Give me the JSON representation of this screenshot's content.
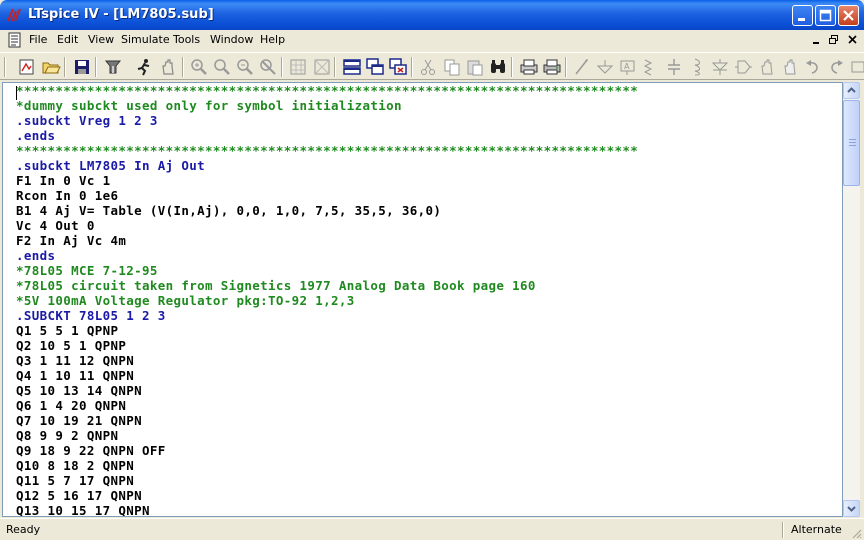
{
  "window": {
    "title": "LTspice IV - [LM7805.sub]"
  },
  "menu": {
    "items": [
      {
        "label": "File"
      },
      {
        "label": "Edit"
      },
      {
        "label": "View"
      },
      {
        "label": "Simulate"
      },
      {
        "label": "Tools"
      },
      {
        "label": "Window"
      },
      {
        "label": "Help"
      }
    ]
  },
  "toolbar": {
    "icons": [
      "new-schematic-icon",
      "open-icon",
      "save-icon",
      "control-panel-icon",
      "run-icon",
      "halt-icon",
      "zoom-in-icon",
      "pan-icon",
      "zoom-out-icon",
      "zoom-fit-icon",
      "autorange-icon",
      "grid-icon",
      "tile-horizontal-icon",
      "cascade-icon",
      "close-all-icon",
      "cut-icon",
      "copy-icon",
      "paste-icon",
      "find-icon",
      "print-setup-icon",
      "print-icon",
      "wire-icon",
      "ground-icon",
      "label-icon",
      "resistor-icon",
      "capacitor-icon",
      "inductor-icon",
      "diode-icon",
      "component-icon",
      "move-icon",
      "drag-icon",
      "undo-icon",
      "redo-icon",
      "rotate-icon"
    ]
  },
  "editor": {
    "lines": [
      {
        "text": "*******************************************************************************",
        "kind": "comment"
      },
      {
        "text": "*dummy subckt used only for symbol initialization",
        "kind": "comment"
      },
      {
        "text": ".subckt Vreg 1 2 3",
        "kind": "dir"
      },
      {
        "text": ".ends",
        "kind": "dir"
      },
      {
        "text": "*******************************************************************************",
        "kind": "comment"
      },
      {
        "text": ".subckt LM7805 In Aj Out",
        "kind": "dir"
      },
      {
        "text": "F1 In 0 Vc 1",
        "kind": "plain"
      },
      {
        "text": "Rcon In 0 1e6",
        "kind": "plain"
      },
      {
        "text": "B1 4 Aj V= Table (V(In,Aj), 0,0, 1,0, 7,5, 35,5, 36,0)",
        "kind": "plain"
      },
      {
        "text": "Vc 4 Out 0",
        "kind": "plain"
      },
      {
        "text": "F2 In Aj Vc 4m",
        "kind": "plain"
      },
      {
        "text": ".ends",
        "kind": "dir"
      },
      {
        "text": "*78L05 MCE 7-12-95",
        "kind": "comment"
      },
      {
        "text": "*78L05 circuit taken from Signetics 1977 Analog Data Book page 160",
        "kind": "comment"
      },
      {
        "text": "*5V 100mA Voltage Regulator pkg:TO-92 1,2,3",
        "kind": "comment"
      },
      {
        "text": ".SUBCKT 78L05 1 2 3",
        "kind": "dir"
      },
      {
        "text": "Q1 5 5 1 QPNP",
        "kind": "plain"
      },
      {
        "text": "Q2 10 5 1 QPNP",
        "kind": "plain"
      },
      {
        "text": "Q3 1 11 12 QNPN",
        "kind": "plain"
      },
      {
        "text": "Q4 1 10 11 QNPN",
        "kind": "plain"
      },
      {
        "text": "Q5 10 13 14 QNPN",
        "kind": "plain"
      },
      {
        "text": "Q6 1 4 20 QNPN",
        "kind": "plain"
      },
      {
        "text": "Q7 10 19 21 QNPN",
        "kind": "plain"
      },
      {
        "text": "Q8 9 9 2 QNPN",
        "kind": "plain"
      },
      {
        "text": "Q9 18 9 22 QNPN OFF",
        "kind": "plain"
      },
      {
        "text": "Q10 8 18 2 QNPN",
        "kind": "plain"
      },
      {
        "text": "Q11 5 7 17 QNPN",
        "kind": "plain"
      },
      {
        "text": "Q12 5 16 17 QNPN",
        "kind": "plain"
      },
      {
        "text": "Q13 10 15 17 QNPN",
        "kind": "plain"
      }
    ]
  },
  "status": {
    "left": "Ready",
    "right": "Alternate"
  },
  "colors": {
    "comment": "#1f8a1f",
    "directive": "#1a1aa6",
    "titlebar": "#0a4fd6"
  }
}
